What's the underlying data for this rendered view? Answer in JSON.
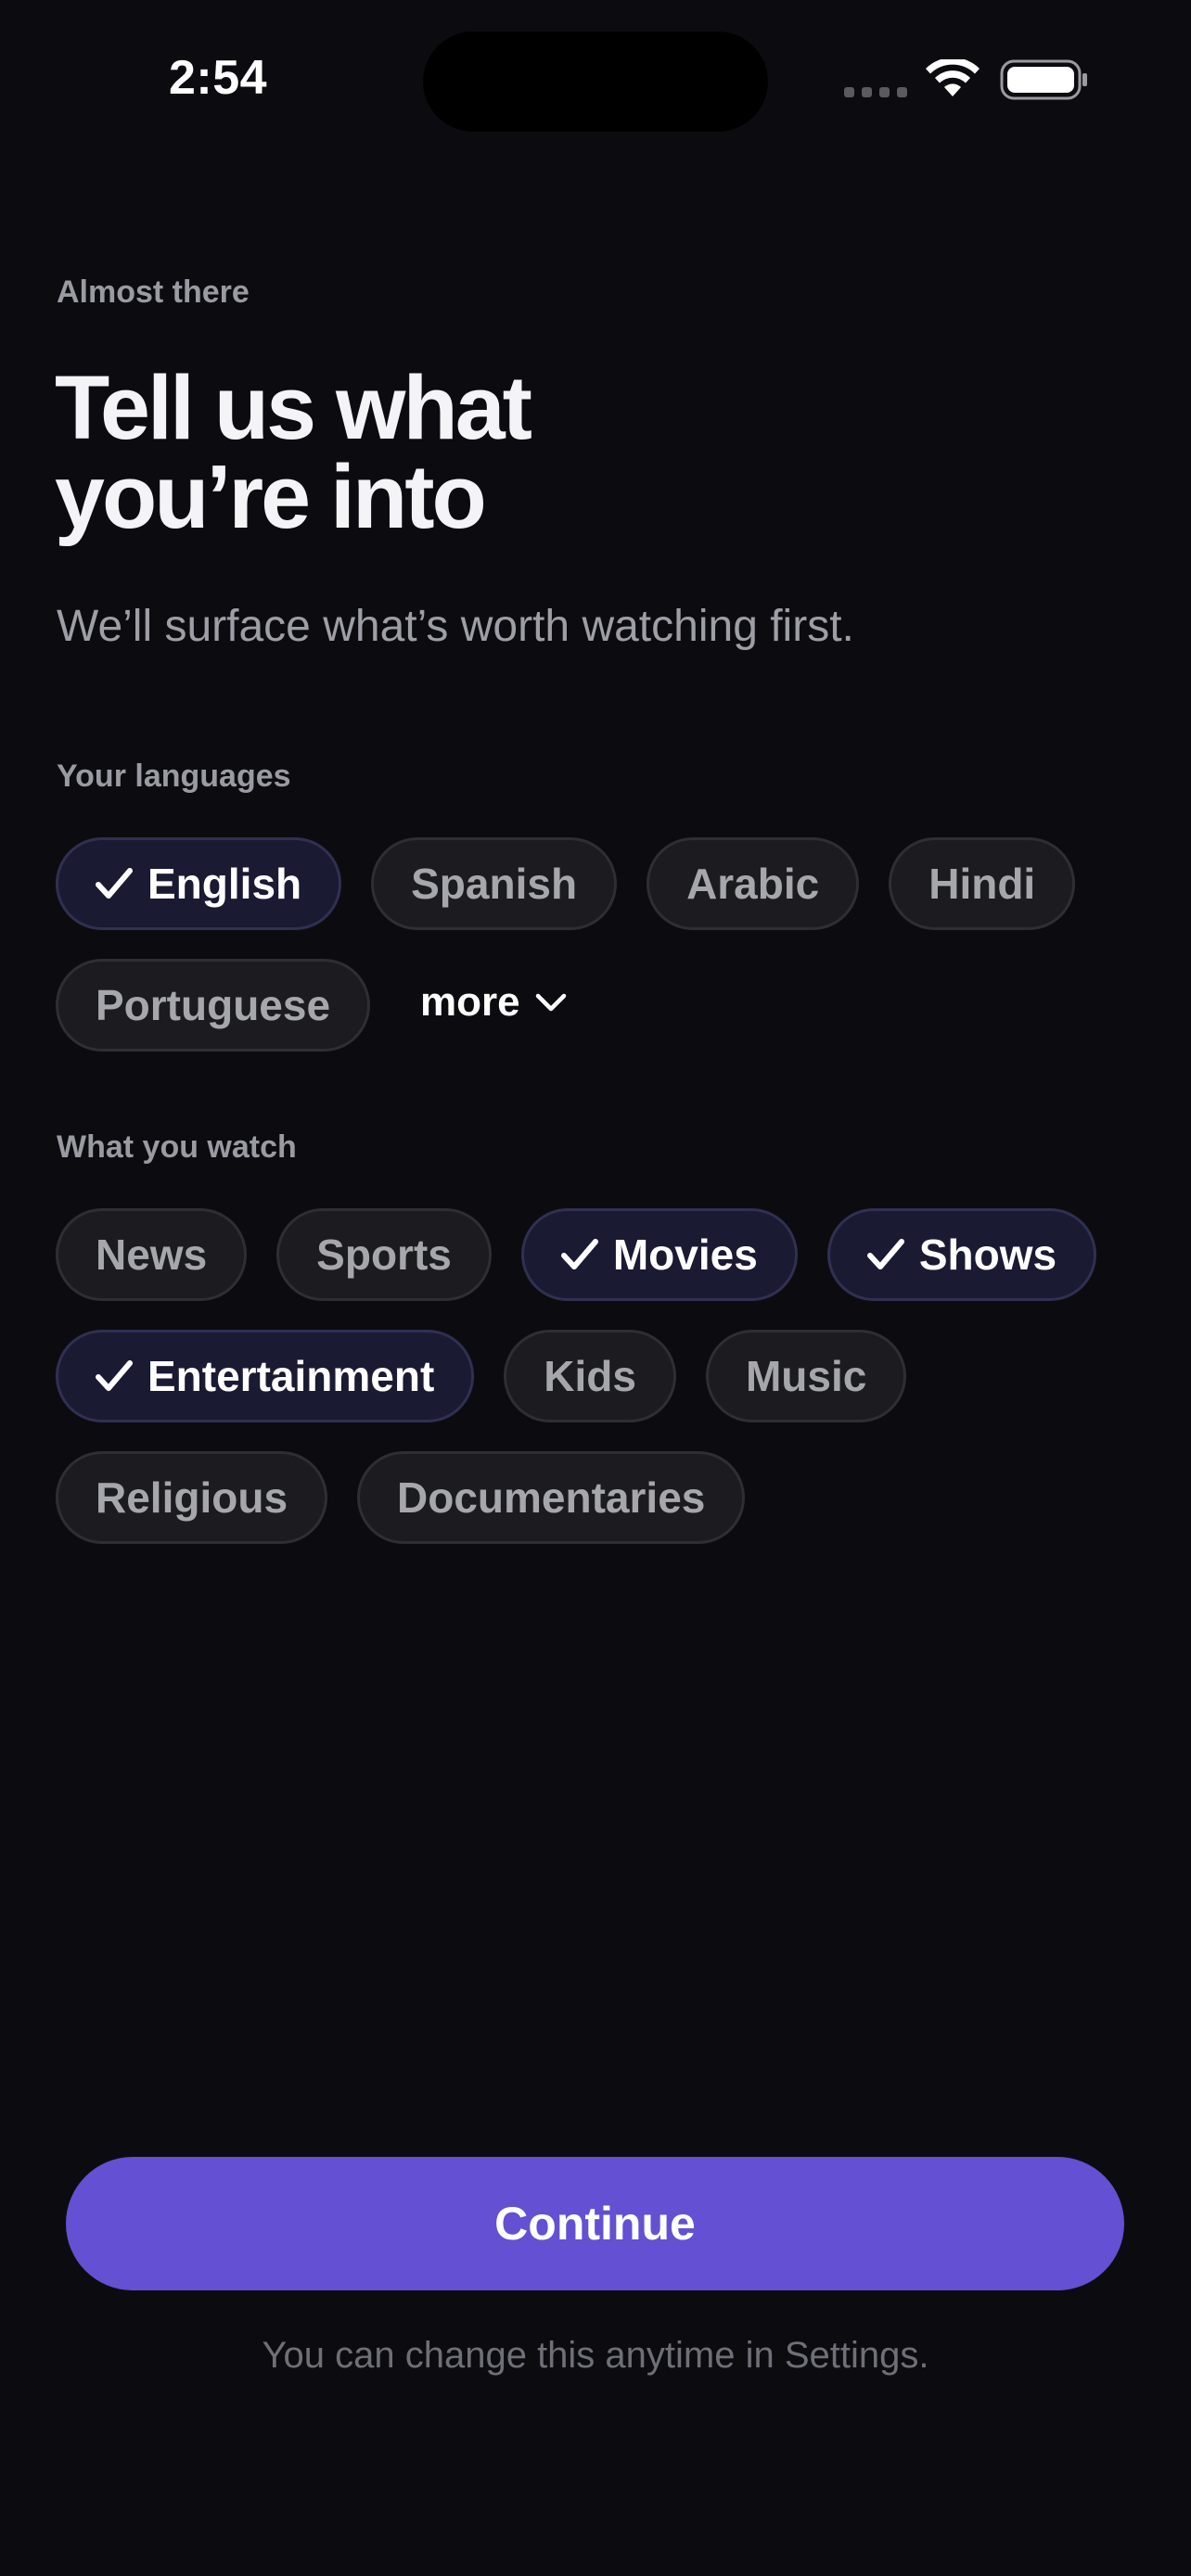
{
  "status_bar": {
    "time": "2:54"
  },
  "header": {
    "eyebrow": "Almost there",
    "title": "Tell us what\nyou’re into",
    "subtitle": "We’ll surface what’s worth watching first."
  },
  "languages": {
    "label": "Your languages",
    "chips": [
      {
        "label": "English",
        "selected": true
      },
      {
        "label": "Spanish",
        "selected": false
      },
      {
        "label": "Arabic",
        "selected": false
      },
      {
        "label": "Hindi",
        "selected": false
      },
      {
        "label": "Portuguese",
        "selected": false
      }
    ],
    "more_label": "more"
  },
  "interests": {
    "label": "What you watch",
    "chips": [
      {
        "label": "News",
        "selected": false
      },
      {
        "label": "Sports",
        "selected": false
      },
      {
        "label": "Movies",
        "selected": true
      },
      {
        "label": "Shows",
        "selected": true
      },
      {
        "label": "Entertainment",
        "selected": true
      },
      {
        "label": "Kids",
        "selected": false
      },
      {
        "label": "Music",
        "selected": false
      },
      {
        "label": "Religious",
        "selected": false
      },
      {
        "label": "Documentaries",
        "selected": false
      }
    ]
  },
  "footer": {
    "continue_label": "Continue",
    "note": "You can change this anytime in Settings."
  },
  "colors": {
    "background": "#0c0c10",
    "accent": "#6350d2",
    "chip_selected_bg": "#1a1a33",
    "chip_bg": "#1c1c20"
  },
  "icons": {
    "check": "check-icon",
    "more": "chevron-down-icon",
    "wifi": "wifi-icon",
    "battery": "battery-icon",
    "signal": "cellular-signal-icon"
  }
}
